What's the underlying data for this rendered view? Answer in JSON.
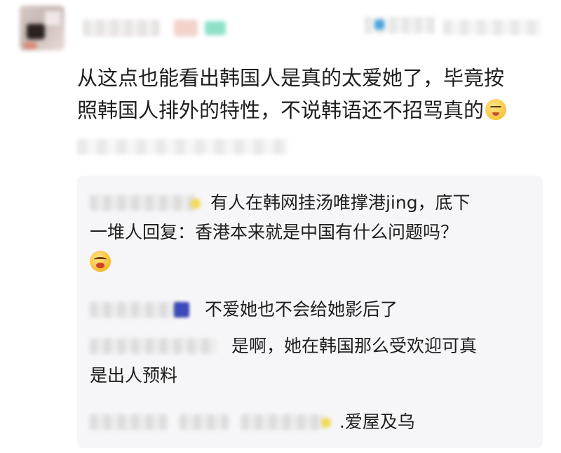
{
  "post": {
    "author_avatar_icon": "avatar-icon",
    "text_line1": "从这点也能看出韩国人是真的太爱她了，毕竟按",
    "text_line2": "照韩国人排外的特性，不说韩语还不招骂真的",
    "emoji_icon": "angry-face-icon"
  },
  "replies": [
    {
      "text_line1": "有人在韩网挂汤唯撑港jing，底下",
      "text_line2": "一堆人回复：香港本来就是中国有什么问题吗？",
      "emoji_icon": "laughing-face-icon"
    },
    {
      "text_line1": "不爱她也不会给她影后了"
    },
    {
      "text_line1": "是啊，她在韩国那么受欢迎可真",
      "text_line2": "是出人预料"
    },
    {
      "text_line1": ".爱屋及乌"
    }
  ],
  "colors": {
    "text": "#1e1e1e",
    "reply_bg": "#f6f6f8",
    "background": "#ffffff"
  }
}
